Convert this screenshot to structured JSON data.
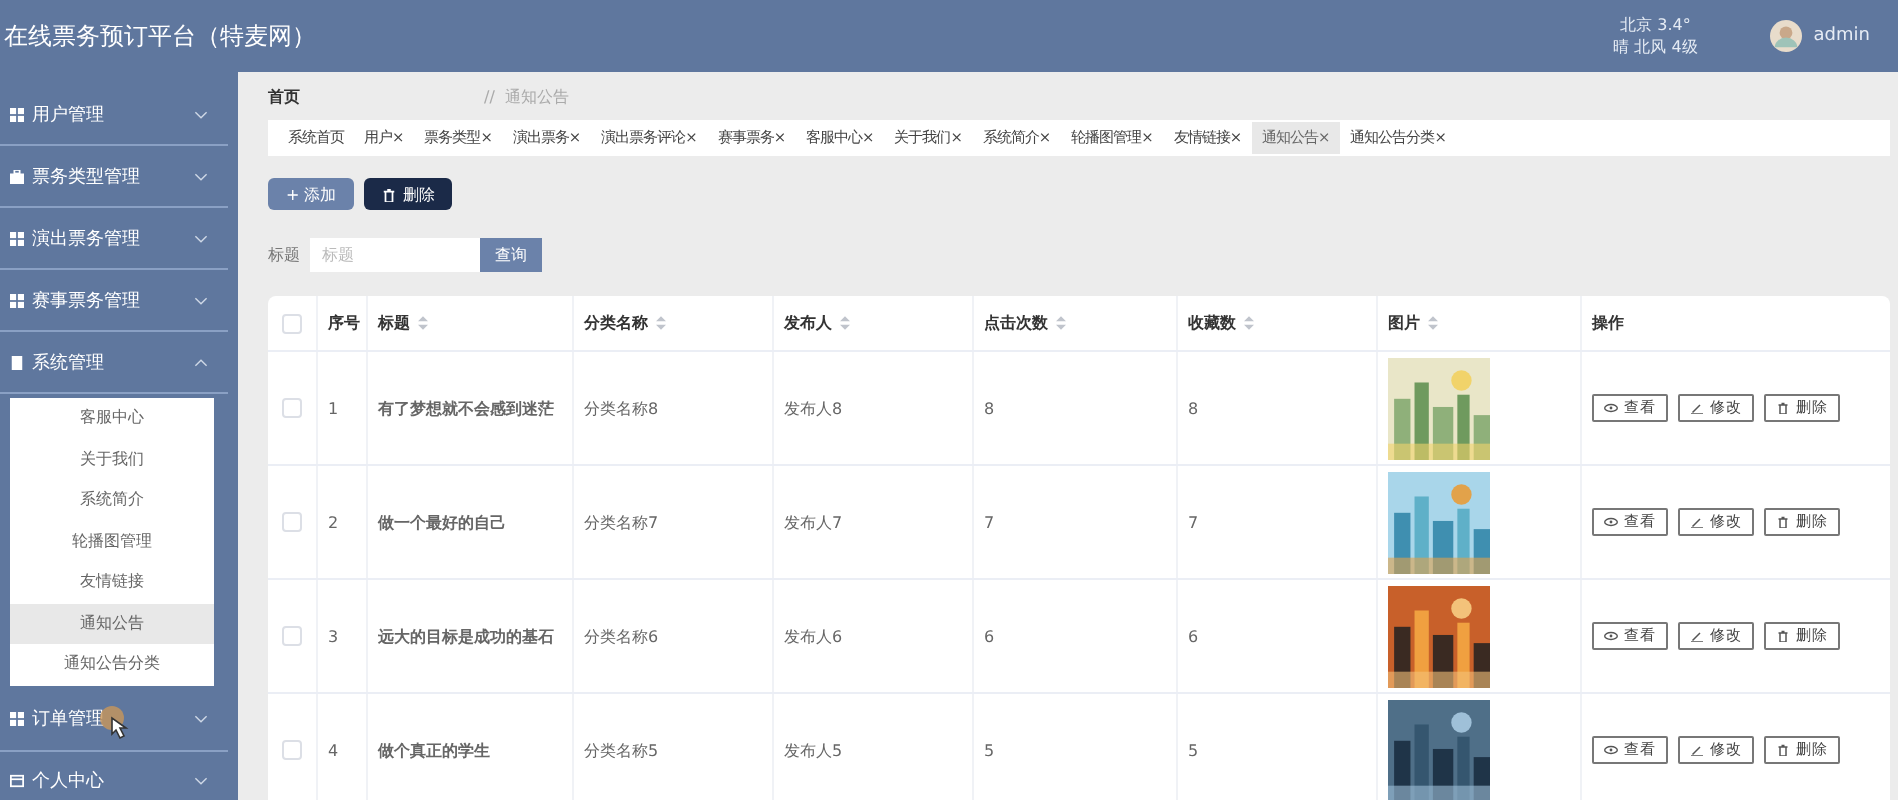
{
  "header": {
    "title": "在线票务预订平台（特麦网）",
    "weather": {
      "city_temp": "北京 3.4°",
      "condition": "晴 北风 4级"
    },
    "user": "admin"
  },
  "sidebar": {
    "items": [
      {
        "label": "用户管理",
        "expanded": false
      },
      {
        "label": "票务类型管理",
        "expanded": false
      },
      {
        "label": "演出票务管理",
        "expanded": false
      },
      {
        "label": "赛事票务管理",
        "expanded": false
      },
      {
        "label": "系统管理",
        "expanded": true,
        "children": [
          {
            "label": "客服中心",
            "selected": false
          },
          {
            "label": "关于我们",
            "selected": false
          },
          {
            "label": "系统简介",
            "selected": false
          },
          {
            "label": "轮播图管理",
            "selected": false
          },
          {
            "label": "友情链接",
            "selected": false
          },
          {
            "label": "通知公告",
            "selected": true
          },
          {
            "label": "通知公告分类",
            "selected": false
          }
        ]
      },
      {
        "label": "订单管理",
        "expanded": false
      },
      {
        "label": "个人中心",
        "expanded": false
      }
    ]
  },
  "breadcrumb": {
    "home": "首页",
    "separator": "//",
    "current": "通知公告"
  },
  "tabs": [
    {
      "label": "系统首页",
      "selected": false
    },
    {
      "label": "用户×",
      "selected": false
    },
    {
      "label": "票务类型×",
      "selected": false
    },
    {
      "label": "演出票务×",
      "selected": false
    },
    {
      "label": "演出票务评论×",
      "selected": false
    },
    {
      "label": "赛事票务×",
      "selected": false
    },
    {
      "label": "客服中心×",
      "selected": false
    },
    {
      "label": "关于我们×",
      "selected": false
    },
    {
      "label": "系统简介×",
      "selected": false
    },
    {
      "label": "轮播图管理×",
      "selected": false
    },
    {
      "label": "友情链接×",
      "selected": false
    },
    {
      "label": "通知公告×",
      "selected": true
    },
    {
      "label": "通知公告分类×",
      "selected": false
    }
  ],
  "toolbar": {
    "add": "+ 添加",
    "delete": "删除"
  },
  "search": {
    "label": "标题",
    "placeholder": "标题",
    "button": "查询"
  },
  "table": {
    "all_checked": false,
    "columns": [
      "序号",
      "标题",
      "分类名称",
      "发布人",
      "点击次数",
      "收藏数",
      "图片",
      "操作"
    ],
    "rows": [
      {
        "checked": false,
        "cells": [
          "1",
          "有了梦想就不会感到迷茫",
          "分类名称8",
          "发布人8",
          "8",
          "8"
        ],
        "image": {
          "kind": "picture"
        },
        "actions": [
          "查看",
          "修改",
          "删除"
        ]
      },
      {
        "checked": false,
        "cells": [
          "2",
          "做一个最好的自己",
          "分类名称7",
          "发布人7",
          "7",
          "7"
        ],
        "image": {
          "kind": "picture"
        },
        "actions": [
          "查看",
          "修改",
          "删除"
        ]
      },
      {
        "checked": false,
        "cells": [
          "3",
          "远大的目标是成功的基石",
          "分类名称6",
          "发布人6",
          "6",
          "6"
        ],
        "image": {
          "kind": "picture"
        },
        "actions": [
          "查看",
          "修改",
          "删除"
        ]
      },
      {
        "checked": false,
        "cells": [
          "4",
          "做个真正的学生",
          "分类名称5",
          "发布人5",
          "5",
          "5"
        ],
        "image": {
          "kind": "picture"
        },
        "actions": [
          "查看",
          "修改",
          "删除"
        ]
      }
    ]
  }
}
